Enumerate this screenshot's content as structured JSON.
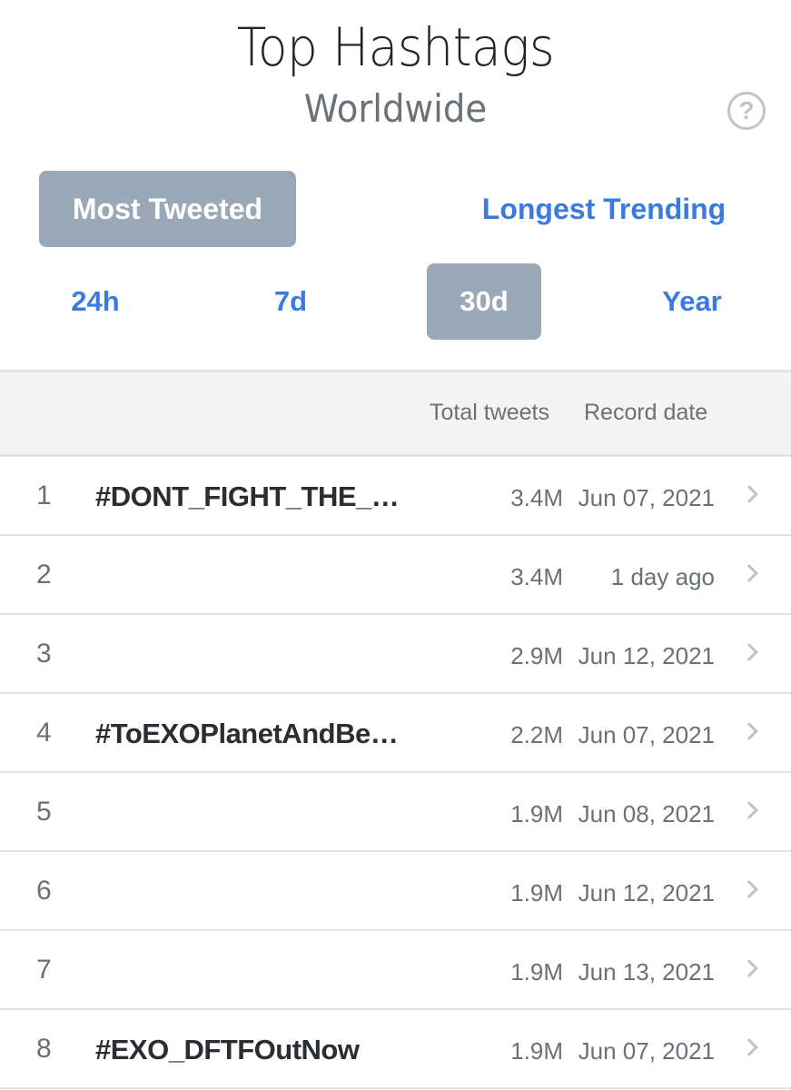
{
  "header": {
    "title": "Top Hashtags",
    "subtitle": "Worldwide",
    "help_icon": "?"
  },
  "modes": {
    "most_tweeted": "Most Tweeted",
    "longest_trending": "Longest Trending",
    "active": "Most Tweeted"
  },
  "ranges": {
    "items": [
      "24h",
      "7d",
      "30d",
      "Year"
    ],
    "active": "30d"
  },
  "table": {
    "columns": {
      "total_tweets": "Total tweets",
      "record_date": "Record date"
    },
    "rows": [
      {
        "rank": "1",
        "tag": "#DONT_FIGHT_THE_…",
        "total": "3.4M",
        "date": "Jun 07, 2021"
      },
      {
        "rank": "2",
        "tag": "",
        "total": "3.4M",
        "date": "1 day ago"
      },
      {
        "rank": "3",
        "tag": "",
        "total": "2.9M",
        "date": "Jun 12, 2021"
      },
      {
        "rank": "4",
        "tag": "#ToEXOPlanetAndBe…",
        "total": "2.2M",
        "date": "Jun 07, 2021"
      },
      {
        "rank": "5",
        "tag": "",
        "total": "1.9M",
        "date": "Jun 08, 2021"
      },
      {
        "rank": "6",
        "tag": "",
        "total": "1.9M",
        "date": "Jun 12, 2021"
      },
      {
        "rank": "7",
        "tag": "",
        "total": "1.9M",
        "date": "Jun 13, 2021"
      },
      {
        "rank": "8",
        "tag": "#EXO_DFTFOutNow",
        "total": "1.9M",
        "date": "Jun 07, 2021"
      }
    ]
  },
  "colors": {
    "accent_blue": "#3a7be0",
    "active_bg": "#9ba8b8"
  }
}
